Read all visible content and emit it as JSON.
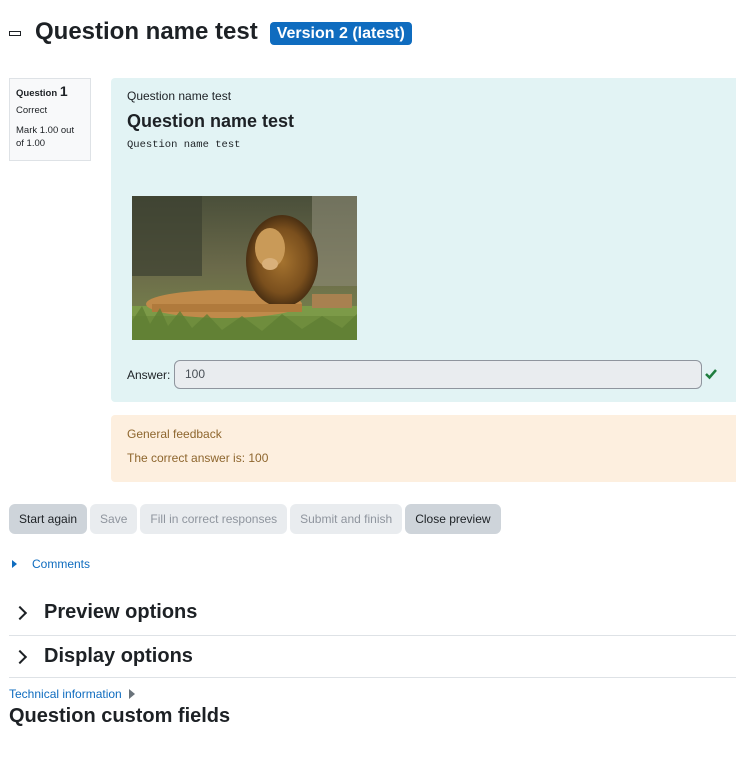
{
  "header": {
    "title": "Question name test",
    "version_badge": "Version 2 (latest)"
  },
  "question_info": {
    "label": "Question",
    "number": "1",
    "state": "Correct",
    "grade": "Mark 1.00 out of 1.00"
  },
  "formulation": {
    "name_small": "Question name test",
    "heading": "Question name test",
    "text": "Question name test",
    "image_icon": "lion-photo",
    "answer_label": "Answer:",
    "answer_value": "100",
    "correct_icon": "check-icon"
  },
  "feedback": {
    "title": "General feedback",
    "text": "The correct answer is: 100"
  },
  "buttons": {
    "start_again": "Start again",
    "save": "Save",
    "fill_correct": "Fill in correct responses",
    "submit_finish": "Submit and finish",
    "close_preview": "Close preview"
  },
  "comments": {
    "label": "Comments"
  },
  "sections": {
    "preview_options": "Preview options",
    "display_options": "Display options"
  },
  "technical_info": {
    "label": "Technical information"
  },
  "custom_fields": {
    "title": "Question custom fields"
  },
  "colors": {
    "accent": "#0f6cbf",
    "formulation_bg": "#e2f3f4",
    "feedback_bg": "#fdefdf",
    "correct": "#1f7e3f"
  }
}
